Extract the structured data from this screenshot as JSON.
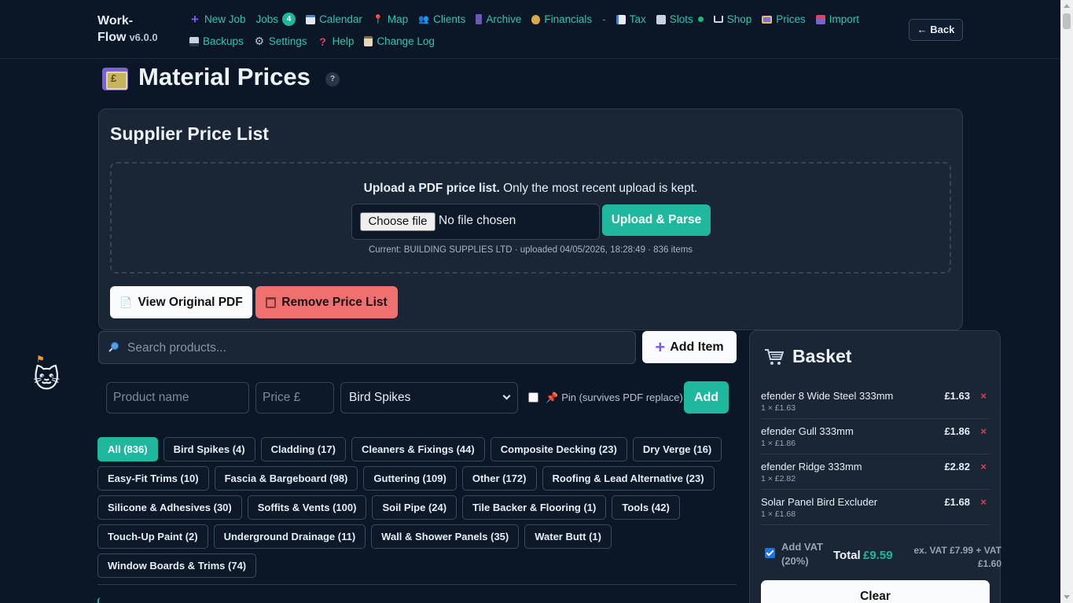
{
  "brand": {
    "name_line1": "Work-",
    "name_line2": "Flow",
    "version": "v6.0.0"
  },
  "nav": {
    "row1": [
      {
        "label": "New Job",
        "icon": "plus-icon"
      },
      {
        "label": "Jobs",
        "icon": "",
        "badge": "4"
      },
      {
        "label": "Calendar",
        "icon": "calendar-icon"
      },
      {
        "label": "Map",
        "icon": "pin-icon"
      },
      {
        "label": "Clients",
        "icon": "people-icon"
      },
      {
        "label": "Archive",
        "icon": "archive-icon"
      },
      {
        "label": "Financials",
        "icon": "moneybag-icon"
      },
      {
        "label": "Tax",
        "icon": "chart-icon"
      },
      {
        "label": "Slots",
        "icon": "slots-icon"
      },
      {
        "label": "Shop",
        "icon": "cart-icon"
      },
      {
        "label": "Prices",
        "icon": "banknote-icon"
      },
      {
        "label": "Import",
        "icon": "inbox-icon"
      }
    ],
    "separator": "-",
    "row2": [
      {
        "label": "Backups",
        "icon": "disk-icon"
      },
      {
        "label": "Settings",
        "icon": "gear-icon"
      },
      {
        "label": "Help",
        "icon": "question-icon"
      },
      {
        "label": "Change Log",
        "icon": "clipboard-icon"
      }
    ],
    "back_label": "← Back"
  },
  "page": {
    "title": "Material Prices",
    "help": "?"
  },
  "supplier": {
    "title": "Supplier Price List",
    "upload_bold": "Upload a PDF price list.",
    "upload_rest": " Only the most recent upload is kept.",
    "choose_file": "Choose file",
    "no_file": "No file chosen",
    "upload_button": "Upload & Parse",
    "current": "Current: BUILDING SUPPLIES LTD · uploaded 04/05/2026, 18:28:49 · 836 items",
    "view_pdf": "View Original PDF",
    "remove": "Remove Price List"
  },
  "search": {
    "placeholder": "Search products...",
    "add_item": "Add Item"
  },
  "new_product": {
    "name_placeholder": "Product name",
    "price_placeholder": "Price £",
    "category_selected": "Bird Spikes",
    "pin_label": "Pin (survives PDF replace)",
    "add": "Add"
  },
  "chips": [
    [
      "All (836)",
      "Bird Spikes (4)",
      "Cladding (17)",
      "Cleaners & Fixings (44)",
      "Composite Decking (23)",
      "Dry Verge (16)"
    ],
    [
      "Easy-Fit Trims (10)",
      "Fascia & Bargeboard (98)",
      "Guttering (109)",
      "Other (172)",
      "Roofing & Lead Alternative (23)"
    ],
    [
      "Silicone & Adhesives (30)",
      "Soffits & Vents (100)",
      "Soil Pipe (24)",
      "Tile Backer & Flooring (1)",
      "Tools (42)"
    ],
    [
      "Touch-Up Paint (2)",
      "Underground Drainage (11)",
      "Wall & Shower Panels (35)",
      "Water Butt (1)"
    ],
    [
      "Window Boards & Trims (74)"
    ]
  ],
  "basket": {
    "title": "Basket",
    "items": [
      {
        "name": "efender 8 Wide Steel 333mm",
        "sub": "1 × £1.63",
        "price": "£1.63",
        "remove": "×"
      },
      {
        "name": "efender Gull 333mm",
        "sub": "1 × £1.86",
        "price": "£1.86",
        "remove": "×"
      },
      {
        "name": "efender Ridge 333mm",
        "sub": "1 × £2.82",
        "price": "£2.82",
        "remove": "×"
      },
      {
        "name": "Solar Panel Bird Excluder",
        "sub": "1 × £1.68",
        "price": "£1.68",
        "remove": "×"
      }
    ],
    "vat_label": "Add VAT (20%)",
    "vat_checked": true,
    "total_label": "Total",
    "total": "£9.59",
    "breakdown": "ex. VAT £7.99 + VAT £1.60",
    "clear": "Clear"
  },
  "colors": {
    "accent": "#1fb89f",
    "danger": "#f07070",
    "background": "#0b1627",
    "card": "#1a2536"
  }
}
